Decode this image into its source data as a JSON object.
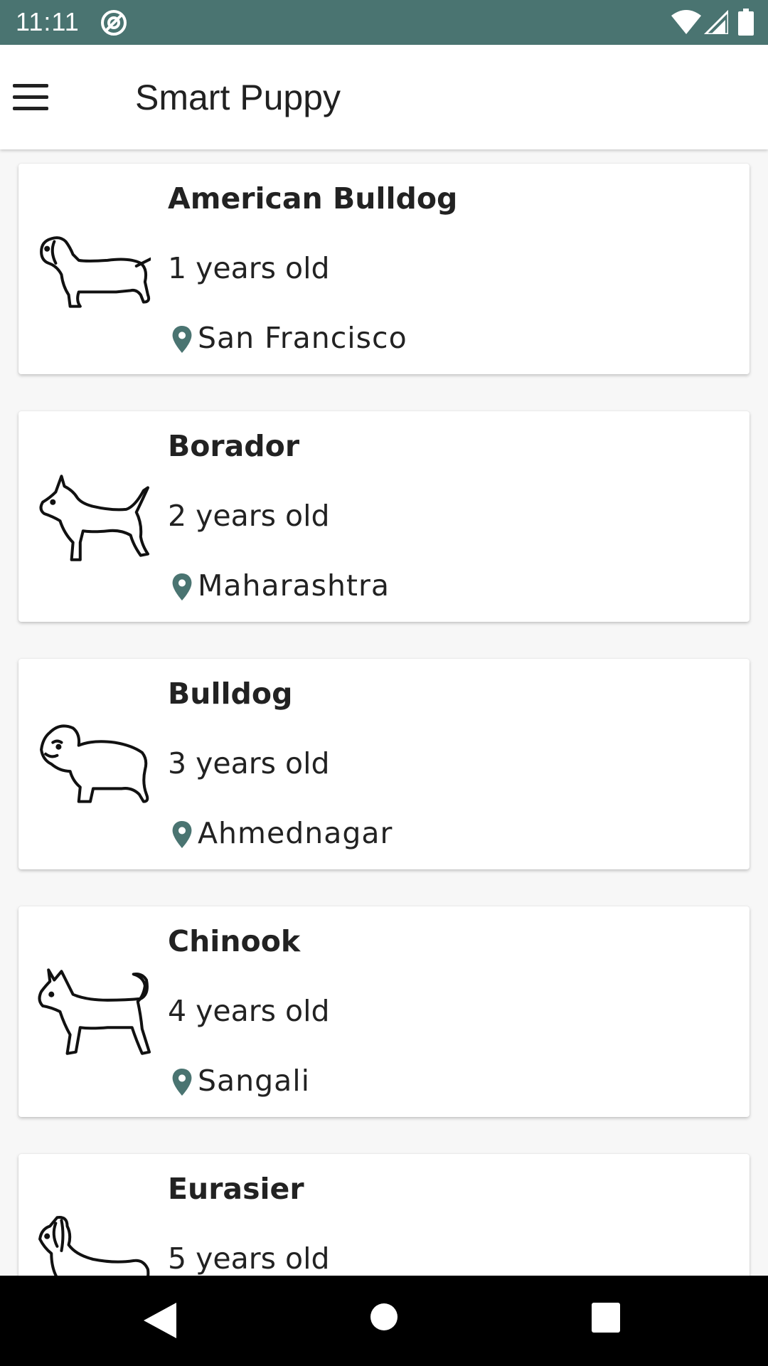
{
  "status_bar": {
    "time": "11:11",
    "icons": [
      "at-sign-notification-icon",
      "wifi-icon",
      "signal-icon",
      "battery-icon"
    ]
  },
  "app_bar": {
    "title": "Smart Puppy",
    "menu_icon": "hamburger-menu-icon"
  },
  "dogs": [
    {
      "name": "American Bulldog",
      "age": "1 years old",
      "location": "San Francisco",
      "icon": "dachshund-icon"
    },
    {
      "name": "Borador",
      "age": "2 years old",
      "location": "Maharashtra",
      "icon": "terrier-icon"
    },
    {
      "name": "Bulldog",
      "age": "3 years old",
      "location": "Ahmednagar",
      "icon": "bulldog-icon"
    },
    {
      "name": "Chinook",
      "age": "4 years old",
      "location": "Sangali",
      "icon": "chihuahua-icon"
    },
    {
      "name": "Eurasier",
      "age": "5 years old",
      "location": "",
      "icon": "longhair-dog-icon"
    }
  ],
  "nav_bar": {
    "icons": [
      "back-icon",
      "home-icon",
      "recents-icon"
    ]
  },
  "colors": {
    "status_bar": "#4a7471",
    "accent": "#4a7471",
    "text": "#222222",
    "background": "#f7f7f7"
  }
}
